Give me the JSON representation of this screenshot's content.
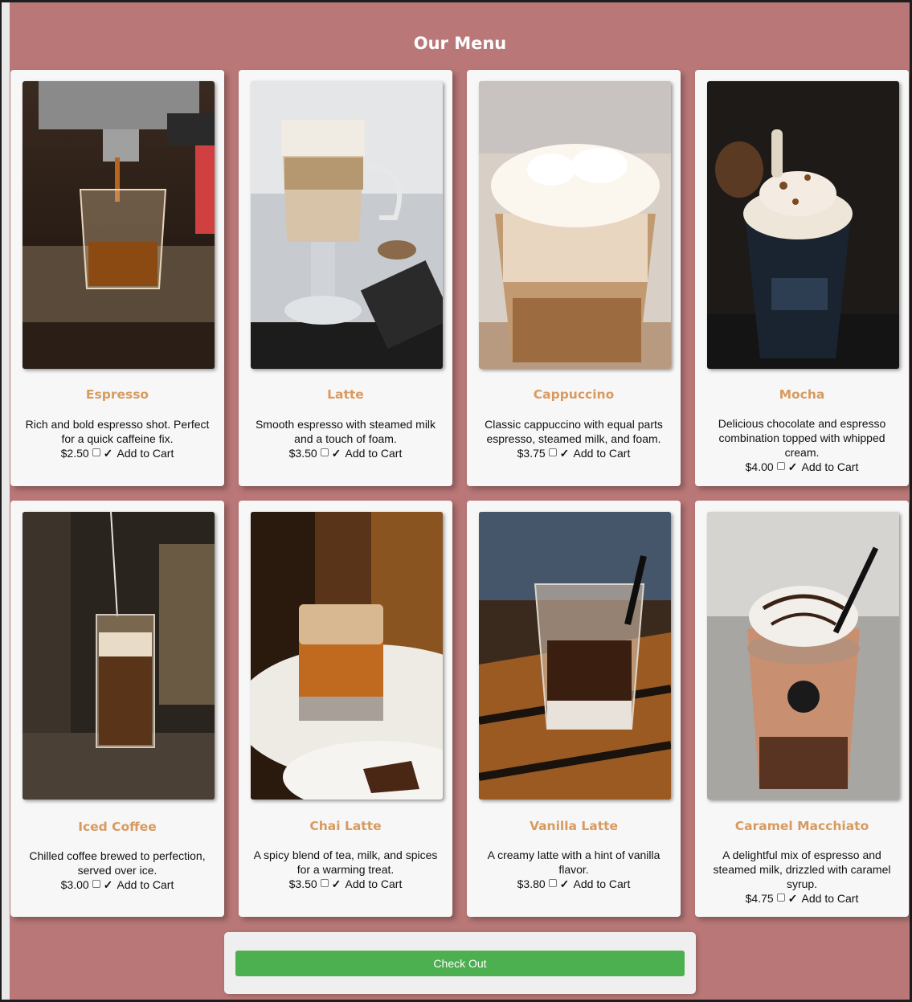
{
  "menu": {
    "title": "Our Menu",
    "items": [
      {
        "name": "Espresso",
        "description": "Rich and bold espresso shot. Perfect for a quick caffeine fix.",
        "price": "$2.50",
        "cart_label": "Add to Cart"
      },
      {
        "name": "Latte",
        "description": "Smooth espresso with steamed milk and a touch of foam.",
        "price": "$3.50",
        "cart_label": "Add to Cart"
      },
      {
        "name": "Cappuccino",
        "description": "Classic cappuccino with equal parts espresso, steamed milk, and foam.",
        "price": "$3.75",
        "cart_label": "Add to Cart"
      },
      {
        "name": "Mocha",
        "description": "Delicious chocolate and espresso combination topped with whipped cream.",
        "price": "$4.00",
        "cart_label": "Add to Cart"
      },
      {
        "name": "Iced Coffee",
        "description": "Chilled coffee brewed to perfection, served over ice.",
        "price": "$3.00",
        "cart_label": "Add to Cart"
      },
      {
        "name": "Chai Latte",
        "description": "A spicy blend of tea, milk, and spices for a warming treat.",
        "price": "$3.50",
        "cart_label": "Add to Cart"
      },
      {
        "name": "Vanilla Latte",
        "description": "A creamy latte with a hint of vanilla flavor.",
        "price": "$3.80",
        "cart_label": "Add to Cart"
      },
      {
        "name": "Caramel Macchiato",
        "description": "A delightful mix of espresso and steamed milk, drizzled with caramel syrup.",
        "price": "$4.75",
        "cart_label": "Add to Cart"
      }
    ]
  },
  "checkout": {
    "label": "Check Out"
  },
  "colors": {
    "background": "#b97777",
    "card": "#f7f7f7",
    "accent": "#d89a5f",
    "button": "#4caf50"
  }
}
